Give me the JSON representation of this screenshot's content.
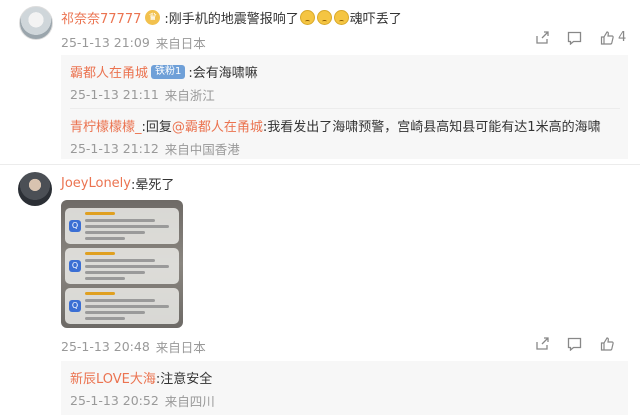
{
  "comments": [
    {
      "user": "祁奈奈77777",
      "text_prefix": ":刚手机的地震警报响了",
      "text_suffix": "魂吓丢了",
      "time": "25-1-13 21:09",
      "source": "来自日本",
      "like_count": "4",
      "replies": [
        {
          "user": "霸都人在甬城",
          "badge": "铁粉1",
          "text": ":会有海啸嘛",
          "time": "25-1-13 21:11",
          "source": "来自浙江"
        },
        {
          "user": "青柠檬檬檬_",
          "reply_label": ":回复",
          "mention": "@霸都人在甬城",
          "text": ":我看发出了海啸预警，宫崎县高知县可能有达1米高的海啸",
          "time": "25-1-13 21:12",
          "source": "来自中国香港"
        }
      ]
    },
    {
      "user": "JoeyLonely",
      "text": ":晕死了",
      "time": "25-1-13 20:48",
      "source": "来自日本",
      "replies": [
        {
          "user": "新辰LOVE大海",
          "text": ":注意安全",
          "time": "25-1-13 20:52",
          "source": "来自四川"
        }
      ]
    }
  ],
  "icons": [
    "share-icon",
    "comment-icon",
    "like-icon"
  ]
}
